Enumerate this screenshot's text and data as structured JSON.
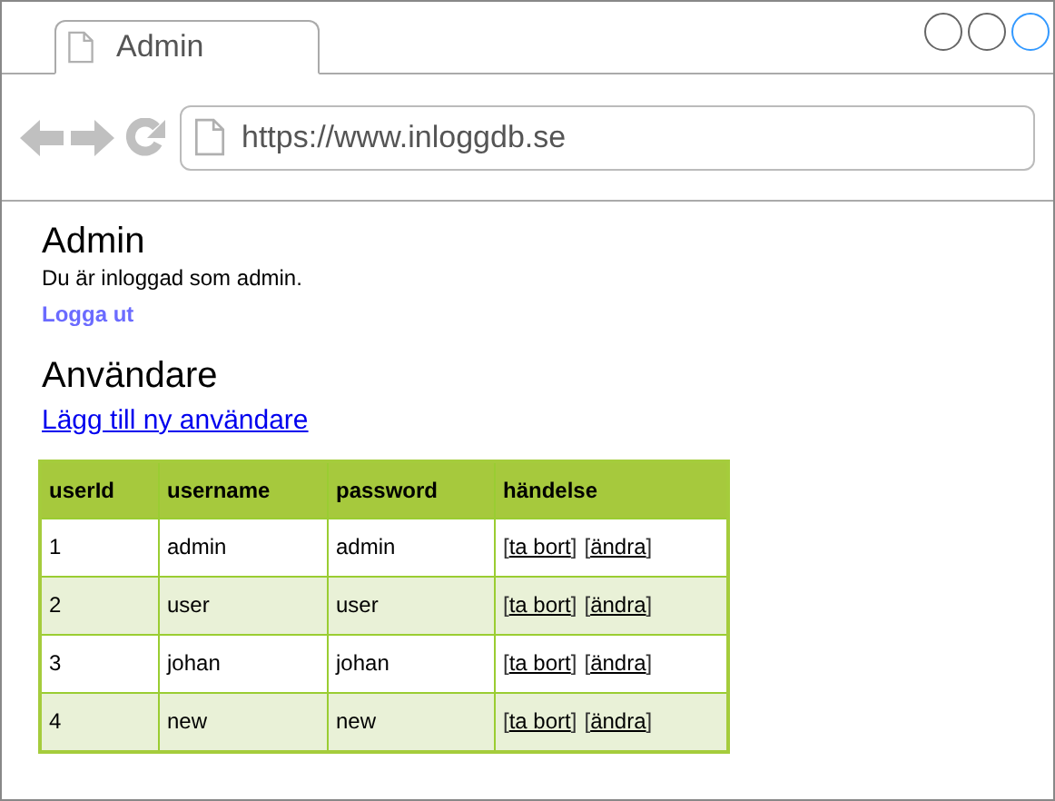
{
  "browser": {
    "tab": {
      "title": "Admin",
      "selected": true
    },
    "address": "https://www.inloggdb.se"
  },
  "page": {
    "title": "Admin",
    "status": "Du är inloggad som admin.",
    "logout": "Logga ut",
    "section_title": "Användare",
    "add_link": "Lägg till ny användare"
  },
  "table": {
    "columns": [
      "userId",
      "username",
      "password",
      "händelse"
    ],
    "bracket_open": "[",
    "bracket_close": "]",
    "rows": [
      {
        "cells": [
          "1",
          "admin",
          "admin"
        ],
        "actions": [
          "ta bort",
          "ändra"
        ]
      },
      {
        "cells": [
          "2",
          "user",
          "user"
        ],
        "actions": [
          "ta bort",
          "ändra"
        ]
      },
      {
        "cells": [
          "3",
          "johan",
          "johan"
        ],
        "actions": [
          "ta bort",
          "ändra"
        ]
      },
      {
        "cells": [
          "4",
          "new",
          "new"
        ],
        "actions": [
          "ta bort",
          "ändra"
        ]
      }
    ]
  }
}
